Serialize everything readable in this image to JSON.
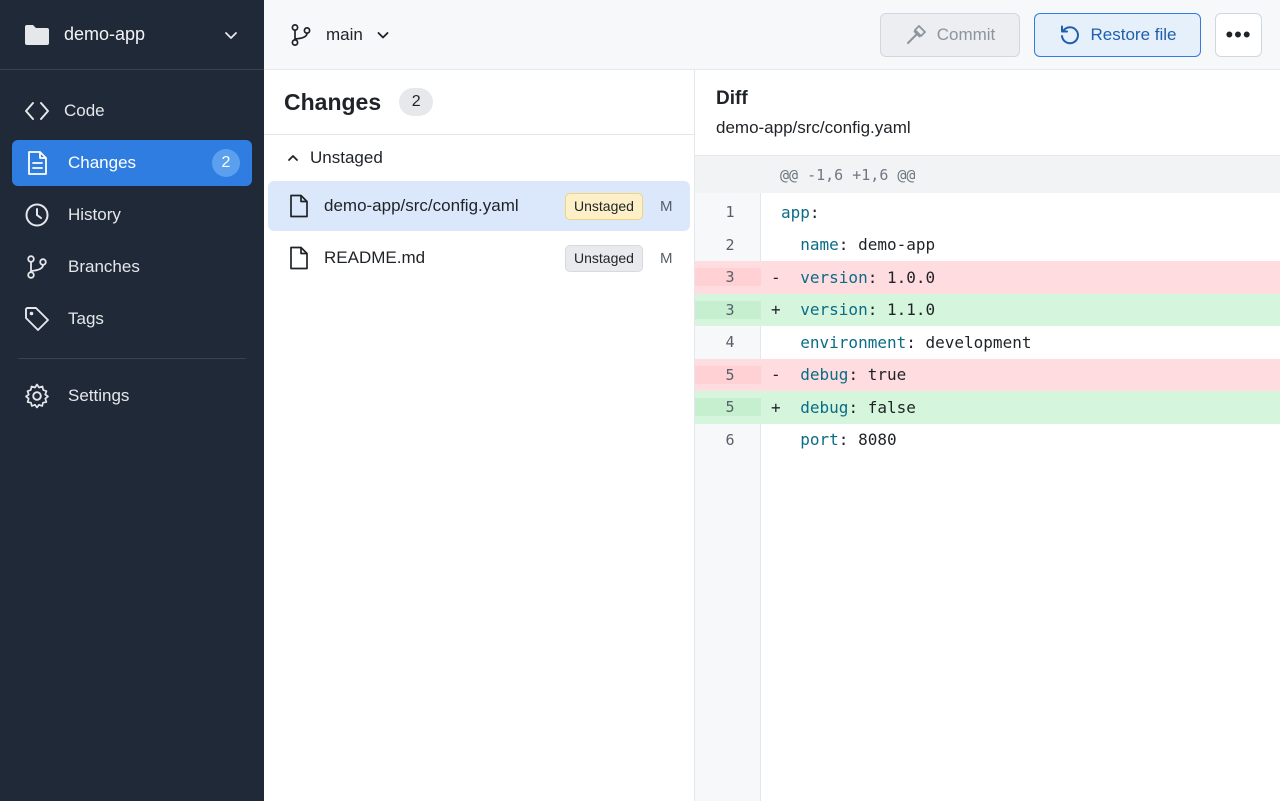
{
  "sidebar": {
    "repo_name": "demo-app",
    "items": [
      {
        "label": "Code"
      },
      {
        "label": "Changes",
        "count": "2"
      },
      {
        "label": "History"
      },
      {
        "label": "Branches"
      },
      {
        "label": "Tags"
      },
      {
        "label": "Settings"
      }
    ]
  },
  "topbar": {
    "branch": "main",
    "commit_label": "Commit",
    "restore_label": "Restore file",
    "more_label": "•••"
  },
  "changes": {
    "title": "Changes",
    "count": "2",
    "group_label": "Unstaged",
    "files": [
      {
        "name": "demo-app/src/config.yaml",
        "tag": "Unstaged",
        "status": "M"
      },
      {
        "name": "README.md",
        "tag": "Unstaged",
        "status": "M"
      }
    ]
  },
  "diff": {
    "title": "Diff",
    "path": "demo-app/src/config.yaml",
    "hunk": "@@ -1,6 +1,6 @@",
    "lines": [
      {
        "num": "1",
        "sign": "",
        "key": "app",
        "sep": ":",
        "value": ""
      },
      {
        "num": "2",
        "sign": "",
        "key": "  name",
        "sep": ": ",
        "value": "demo-app"
      },
      {
        "num": "3",
        "sign": "-",
        "key": "  version",
        "sep": ": ",
        "value": "1.0.0"
      },
      {
        "num": "3",
        "sign": "+",
        "key": "  version",
        "sep": ": ",
        "value": "1.1.0"
      },
      {
        "num": "4",
        "sign": "",
        "key": "  environment",
        "sep": ": ",
        "value": "development"
      },
      {
        "num": "5",
        "sign": "-",
        "key": "  debug",
        "sep": ": ",
        "value": "true"
      },
      {
        "num": "5",
        "sign": "+",
        "key": "  debug",
        "sep": ": ",
        "value": "false"
      },
      {
        "num": "6",
        "sign": "",
        "key": "  port",
        "sep": ": ",
        "value": "8080"
      }
    ]
  },
  "colors": {
    "sidebar_bg": "#1f2937",
    "accent": "#2f7de0",
    "deleted_bg": "#ffdcdf",
    "added_bg": "#d6f5dd"
  }
}
